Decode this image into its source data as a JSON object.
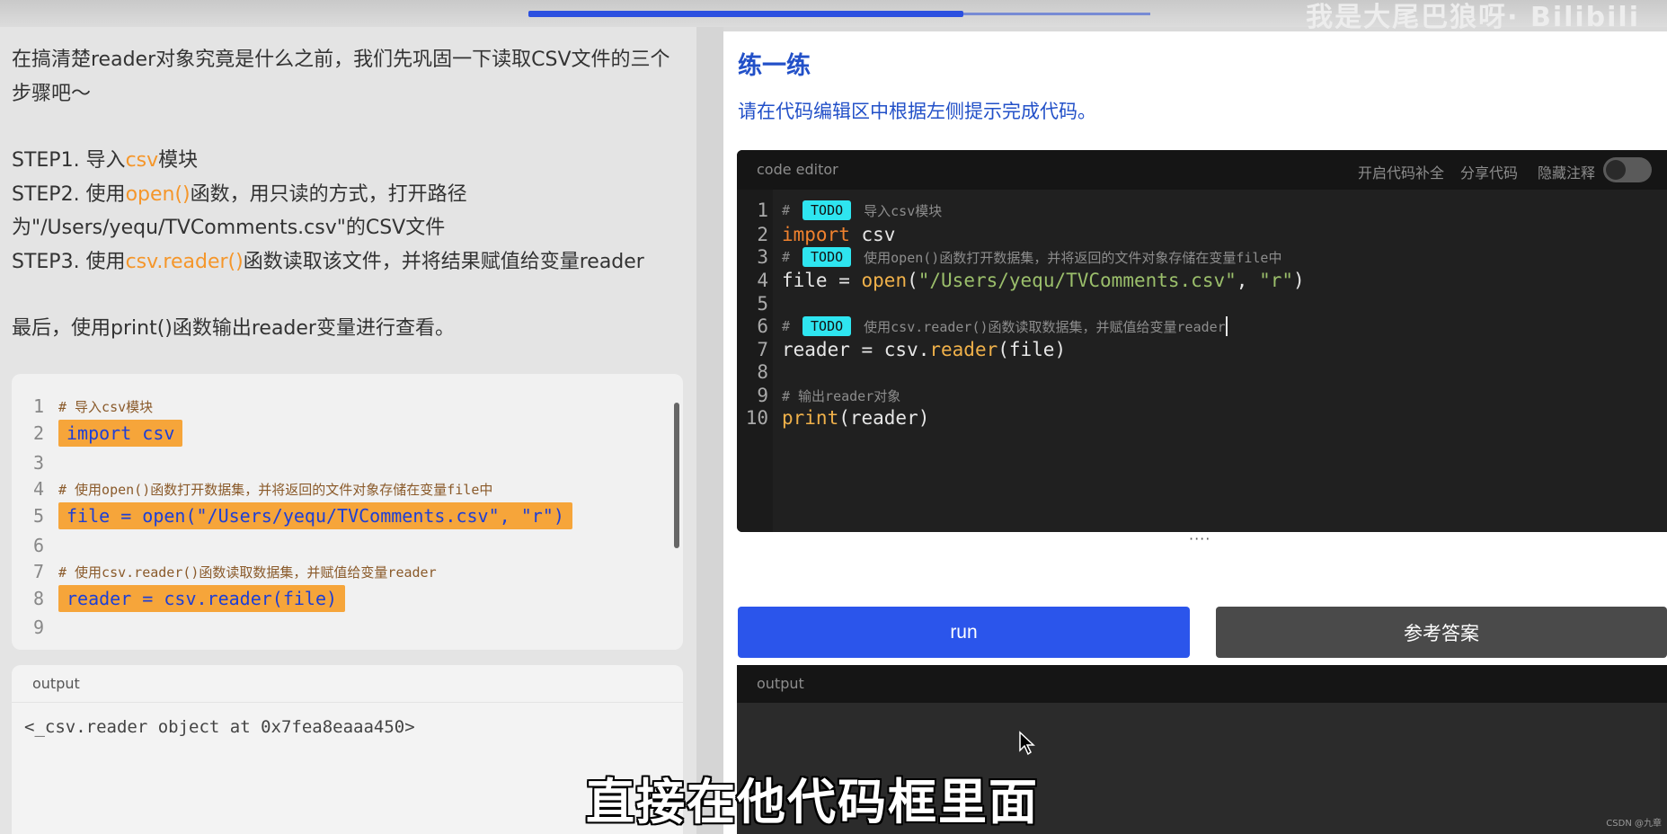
{
  "topbar": {
    "progress_percent": 70,
    "watermark": "我是大尾巴狼呀· Bilibili"
  },
  "intro": {
    "para1": "在搞清楚reader对象究竟是什么之前，我们先巩固一下读取CSV文件的三个步骤吧～",
    "step1_prefix": "STEP1. 导入",
    "step1_hl": "csv",
    "step1_suffix": "模块",
    "step2_prefix": "STEP2. 使用",
    "step2_hl": "open()",
    "step2_suffix": "函数，用只读的方式，打开路径为\"/Users/yequ/TVComments.csv\"的CSV文件",
    "step3_prefix": "STEP3. 使用",
    "step3_hl": "csv.reader()",
    "step3_suffix": "函数读取该文件，并将结果赋值给变量reader",
    "final": "最后，使用print()函数输出reader变量进行查看。"
  },
  "sample_code": {
    "lines": [
      {
        "n": "1",
        "comment": "# 导入csv模块"
      },
      {
        "n": "2",
        "code": "import csv"
      },
      {
        "n": "3"
      },
      {
        "n": "4",
        "comment": "# 使用open()函数打开数据集，并将返回的文件对象存储在变量file中"
      },
      {
        "n": "5",
        "code": "file = open(\"/Users/yequ/TVComments.csv\", \"r\")"
      },
      {
        "n": "6"
      },
      {
        "n": "7",
        "comment": "# 使用csv.reader()函数读取数据集，并赋值给变量reader"
      },
      {
        "n": "8",
        "code": "reader = csv.reader(file)"
      },
      {
        "n": "9"
      }
    ]
  },
  "left_output": {
    "label": "output",
    "text": "<_csv.reader object at 0x7fea8eaaa450>"
  },
  "practice": {
    "title": "练一练",
    "hint": "请在代码编辑区中根据左侧提示完成代码。"
  },
  "editor": {
    "title": "code editor",
    "autocomplete": "开启代码补全",
    "share": "分享代码",
    "hide_comments": "隐藏注释",
    "todo_label": "TODO",
    "comment1": "导入csv模块",
    "line2_kw": "import",
    "line2_rest": " csv",
    "comment3": "使用open()函数打开数据集，并将返回的文件对象存储在变量file中",
    "line4_a": "file = ",
    "line4_fn": "open",
    "line4_b": "(",
    "line4_s1": "\"/Users/yequ/TVComments.csv\"",
    "line4_c": ", ",
    "line4_s2": "\"r\"",
    "line4_d": ")",
    "comment6": "使用csv.reader()函数读取数据集，并赋值给变量reader",
    "line7_a": "reader = csv.",
    "line7_fn": "reader",
    "line7_b": "(file)",
    "comment9": "# 输出reader对象",
    "line10_fn": "print",
    "line10_b": "(reader)",
    "hash": "#",
    "line_numbers": [
      "1",
      "2",
      "3",
      "4",
      "5",
      "6",
      "7",
      "8",
      "9",
      "10"
    ]
  },
  "buttons": {
    "run": "run",
    "answer": "参考答案"
  },
  "right_output": {
    "label": "output"
  },
  "subtitle": "直接在他代码框里面",
  "credit": "CSDN @九章"
}
